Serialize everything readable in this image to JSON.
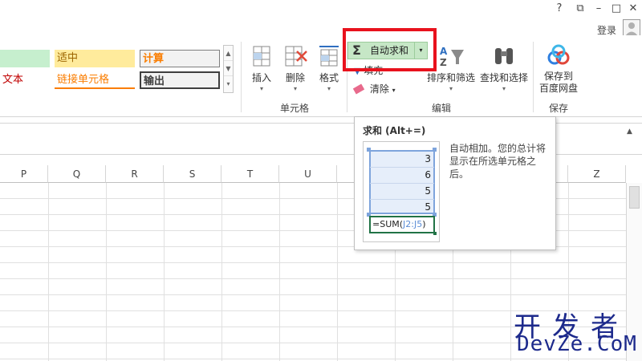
{
  "window": {
    "help": "?",
    "restore_ribbon": "⧉",
    "minimize": "–",
    "maximize": "□",
    "close": "✕",
    "login": "登录"
  },
  "styles": {
    "good": "",
    "neutral": "适中",
    "calc": "计算",
    "warn": "文本",
    "link": "链接单元格",
    "output": "输出"
  },
  "ribbon": {
    "insert": "插入",
    "delete": "删除",
    "format": "格式",
    "cells_group": "单元格",
    "autosum": "自动求和",
    "fill": "填充",
    "clear": "清除",
    "sort_filter": "排序和筛选",
    "find_select": "查找和选择",
    "edit_group": "编辑",
    "save_to_baidu_line1": "保存到",
    "save_to_baidu_line2": "百度网盘",
    "save_group": "保存"
  },
  "columns": [
    "P",
    "Q",
    "R",
    "S",
    "T",
    "U",
    "Z"
  ],
  "tooltip": {
    "title": "求和 (Alt+=)",
    "description": "自动相加。您的总计将显示在所选单元格之后。",
    "preview_values": [
      "3",
      "6",
      "5",
      "5"
    ],
    "formula_prefix": "=SUM(",
    "formula_ref": "J2:J5",
    "formula_suffix": ")"
  },
  "watermark": {
    "line1": "开发者",
    "line2": "DevZe.CoM"
  },
  "colors": {
    "autosum_bg": "#c6e7c6",
    "highlight": "#e8121d",
    "watermark": "#1d2a8c"
  }
}
